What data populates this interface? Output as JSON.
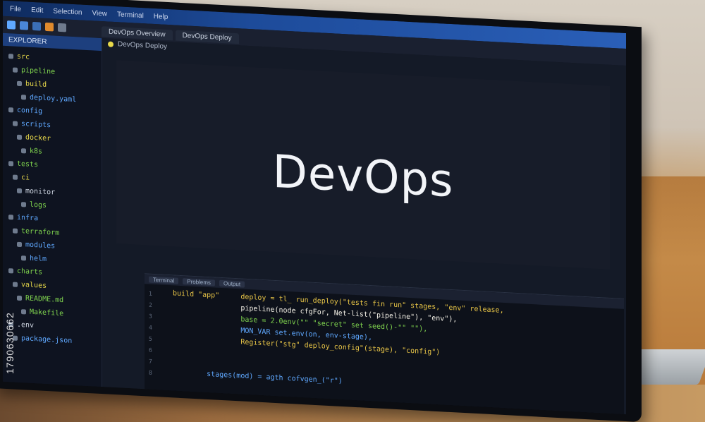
{
  "watermark": {
    "text": "1790630662"
  },
  "window": {
    "menu": [
      "File",
      "Edit",
      "Selection",
      "View",
      "Terminal",
      "Help"
    ],
    "tabs": [
      "DevOps Overview",
      "DevOps Deploy"
    ]
  },
  "sidebar": {
    "header": "EXPLORER",
    "items": [
      {
        "label": "src",
        "color": "#e8d94a"
      },
      {
        "label": "pipeline",
        "color": "#7fd34e"
      },
      {
        "label": "build",
        "color": "#e8d94a"
      },
      {
        "label": "deploy.yaml",
        "color": "#5fa8ff"
      },
      {
        "label": "config",
        "color": "#5fa8ff"
      },
      {
        "label": "scripts",
        "color": "#5fa8ff"
      },
      {
        "label": "docker",
        "color": "#e8d94a"
      },
      {
        "label": "k8s",
        "color": "#7fd34e"
      },
      {
        "label": "tests",
        "color": "#7fd34e"
      },
      {
        "label": "ci",
        "color": "#e8d94a"
      },
      {
        "label": "monitor",
        "color": "#cfd6e2"
      },
      {
        "label": "logs",
        "color": "#7fd34e"
      },
      {
        "label": "infra",
        "color": "#5fa8ff"
      },
      {
        "label": "terraform",
        "color": "#7fd34e"
      },
      {
        "label": "modules",
        "color": "#5fa8ff"
      },
      {
        "label": "helm",
        "color": "#5fa8ff"
      },
      {
        "label": "charts",
        "color": "#7fd34e"
      },
      {
        "label": "values",
        "color": "#e8d94a"
      },
      {
        "label": "README.md",
        "color": "#7fd34e"
      },
      {
        "label": "Makefile",
        "color": "#7fd34e"
      },
      {
        "label": ".env",
        "color": "#cfd6e2"
      },
      {
        "label": "package.json",
        "color": "#5fa8ff"
      }
    ]
  },
  "editor": {
    "tab_label": "DevOps Deploy",
    "hero": "DevOps"
  },
  "terminal": {
    "tabs": [
      "Terminal",
      "Problems",
      "Output"
    ],
    "gutter": [
      "1",
      "2",
      "3",
      "4",
      "5",
      "6",
      "7",
      "8"
    ],
    "lines": [
      "build \"app\"     deploy = tl_ run_deploy(\"tests fin run\" stages, \"env\" release,",
      "                pipeline(node cfgFor, Net-list(\"pipeline\"), \"env\"),",
      "                base = 2.0env(\"\" \"secret\" set seed()-\"\" \"\"),",
      "                MON_VAR set.env(on, env-stage),",
      "                Register(\"stg\" deploy_config\"(stage), \"config\")",
      "",
      "",
      "        stages(mod) = agth cofvgen_(\"r\")"
    ]
  }
}
